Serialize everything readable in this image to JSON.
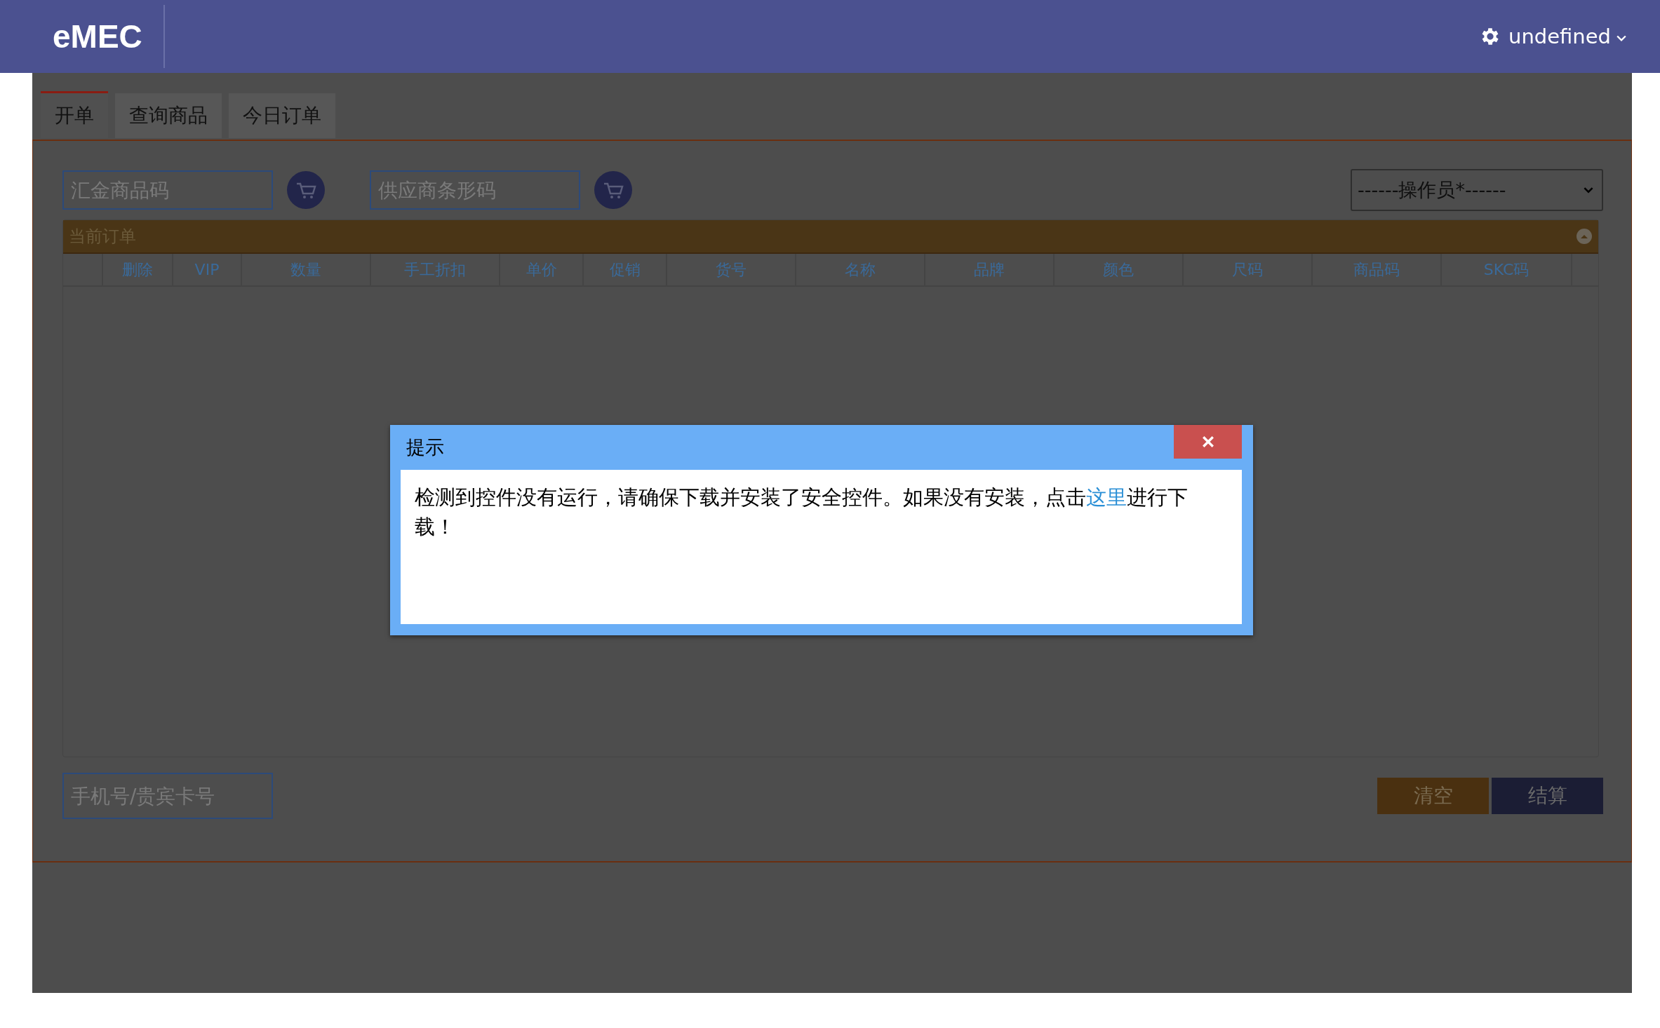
{
  "header": {
    "logo": "eMEC",
    "user": "undefined"
  },
  "tabs": [
    {
      "label": "开单",
      "selected": true
    },
    {
      "label": "查询商品",
      "selected": false
    },
    {
      "label": "今日订单",
      "selected": false
    }
  ],
  "search": [
    {
      "placeholder": "汇金商品码"
    },
    {
      "placeholder": "供应商条形码"
    }
  ],
  "operator_select": {
    "value": "------操作员*------"
  },
  "order_panel": {
    "title": "当前订单",
    "columns": [
      "删除",
      "VIP",
      "数量",
      "手工折扣",
      "单价",
      "促销",
      "货号",
      "名称",
      "品牌",
      "颜色",
      "尺码",
      "商品码",
      "SKC码"
    ]
  },
  "member_field": {
    "placeholder": "手机号/贵宾卡号"
  },
  "buttons": [
    {
      "label": "清空",
      "kind": "clear"
    },
    {
      "label": "结算",
      "kind": "checkout"
    }
  ],
  "dialog": {
    "title": "提示",
    "message_before": "检测到控件没有运行，请确保下载并安装了安全控件。如果没有安装，点击",
    "link": "这里",
    "message_after": "进行下载！"
  }
}
